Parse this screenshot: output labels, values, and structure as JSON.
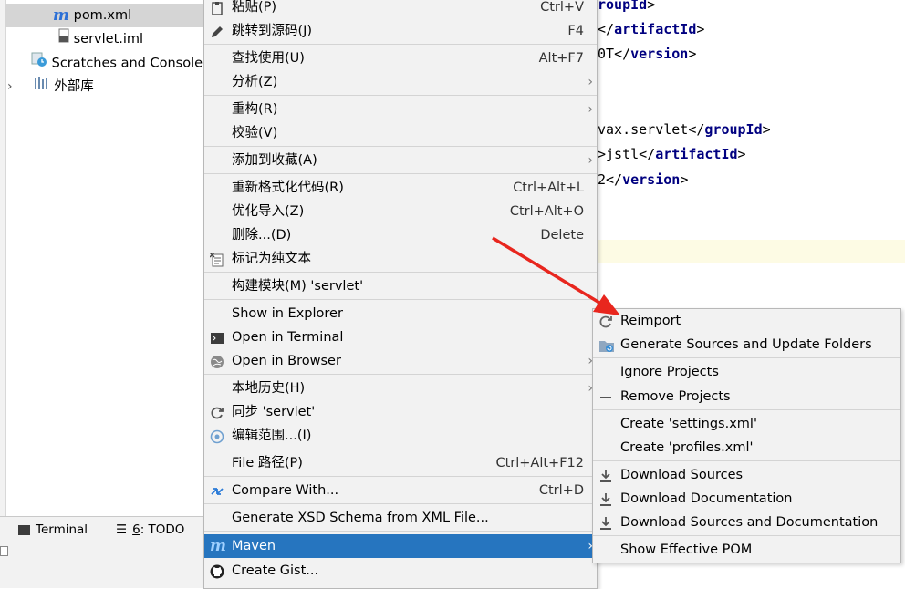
{
  "tree": {
    "items": [
      {
        "label": "pom.xml",
        "icon": "maven-file-icon",
        "selected": true
      },
      {
        "label": "servlet.iml",
        "icon": "iml-file-icon"
      },
      {
        "label": "Scratches and Consoles",
        "icon": "scratches-icon"
      },
      {
        "label": "外部库",
        "icon": "library-icon"
      }
    ]
  },
  "bottom": {
    "terminal_tab": "Terminal",
    "todo_tab_num": "6",
    "todo_tab_label": ": TODO"
  },
  "editor": {
    "lines": [
      {
        "pre": "",
        "tag": "roupId",
        "post": ">",
        "close": false
      },
      {
        "pre": "",
        "tag": "artifactId",
        "post": ">",
        "close": true
      },
      {
        "pre": "0T",
        "tag": "version",
        "post": ">",
        "close": true
      },
      {
        "pre": "vax.servlet",
        "tag": "groupId",
        "post": ">",
        "close": true
      },
      {
        "pre": ">jstl",
        "tag": "artifactId",
        "post": ">",
        "close": true
      },
      {
        "pre": "2",
        "tag": "version",
        "post": ">",
        "close": true
      }
    ]
  },
  "menu": {
    "items": [
      {
        "label": "粘贴(P)",
        "shortcut": "Ctrl+V",
        "icon": "paste-icon"
      },
      {
        "label": "跳转到源码(J)",
        "shortcut": "F4",
        "icon": "edit-icon"
      },
      {
        "label": "查找使用(U)",
        "shortcut": "Alt+F7"
      },
      {
        "label": "分析(Z)",
        "submenu": true
      },
      {
        "label": "重构(R)",
        "submenu": true
      },
      {
        "label": "校验(V)"
      },
      {
        "label": "添加到收藏(A)",
        "submenu": true
      },
      {
        "label": "重新格式化代码(R)",
        "shortcut": "Ctrl+Alt+L"
      },
      {
        "label": "优化导入(Z)",
        "shortcut": "Ctrl+Alt+O"
      },
      {
        "label": "删除...(D)",
        "shortcut": "Delete"
      },
      {
        "label": "标记为纯文本",
        "icon": "plain-text-icon"
      },
      {
        "label": "构建模块(M) 'servlet'"
      },
      {
        "label": "Show in Explorer"
      },
      {
        "label": "Open in Terminal",
        "icon": "terminal-icon"
      },
      {
        "label": "Open in Browser",
        "icon": "globe-icon",
        "submenu": true
      },
      {
        "label": "本地历史(H)",
        "submenu": true
      },
      {
        "label": "同步 'servlet'",
        "icon": "sync-icon"
      },
      {
        "label": "编辑范围...(I)",
        "icon": "scope-icon"
      },
      {
        "label": "File 路径(P)",
        "shortcut": "Ctrl+Alt+F12"
      },
      {
        "label": "Compare With...",
        "shortcut": "Ctrl+D",
        "icon": "compare-icon"
      },
      {
        "label": "Generate XSD Schema from XML File..."
      },
      {
        "label": "Maven",
        "icon": "maven-icon",
        "submenu": true,
        "active": true
      },
      {
        "label": "Create Gist...",
        "icon": "github-icon"
      }
    ]
  },
  "submenu": {
    "items": [
      {
        "label": "Reimport",
        "icon": "reimport-icon"
      },
      {
        "label": "Generate Sources and Update Folders",
        "icon": "generate-sources-icon"
      },
      {
        "label": "Ignore Projects"
      },
      {
        "label": "Remove Projects",
        "icon": "minus-icon"
      },
      {
        "label": "Create 'settings.xml'"
      },
      {
        "label": "Create 'profiles.xml'"
      },
      {
        "label": "Download Sources",
        "icon": "download-icon"
      },
      {
        "label": "Download Documentation",
        "icon": "download-icon"
      },
      {
        "label": "Download Sources and Documentation",
        "icon": "download-icon"
      },
      {
        "label": "Show Effective POM"
      }
    ]
  },
  "colors": {
    "selection": "#2675bf",
    "annotation_arrow": "#e8261e",
    "xml_tag": "#000080"
  }
}
